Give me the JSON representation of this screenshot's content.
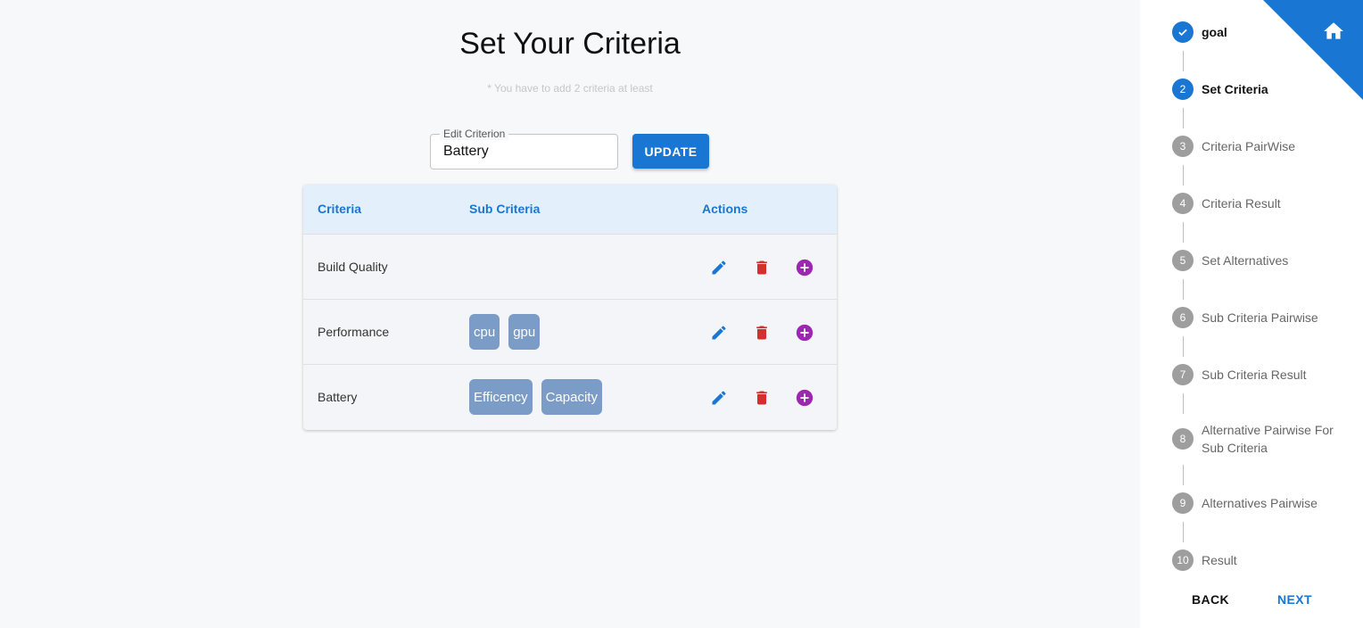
{
  "header": {
    "title": "Set Your Criteria",
    "hint": "* You have to add 2 criteria at least"
  },
  "edit_field": {
    "label": "Edit Criterion",
    "value": "Battery"
  },
  "update_label": "UPDATE",
  "table": {
    "headers": [
      "Criteria",
      "Sub Criteria",
      "Actions"
    ],
    "rows": [
      {
        "name": "Build Quality",
        "sub": []
      },
      {
        "name": "Performance",
        "sub": [
          "cpu",
          "gpu"
        ]
      },
      {
        "name": "Battery",
        "sub": [
          "Efficency",
          "Capacity"
        ]
      }
    ]
  },
  "stepper": {
    "steps": [
      {
        "num": "1",
        "label": "goal",
        "state": "done"
      },
      {
        "num": "2",
        "label": "Set Criteria",
        "state": "active"
      },
      {
        "num": "3",
        "label": "Criteria PairWise",
        "state": "pending"
      },
      {
        "num": "4",
        "label": "Criteria Result",
        "state": "pending"
      },
      {
        "num": "5",
        "label": "Set Alternatives",
        "state": "pending"
      },
      {
        "num": "6",
        "label": "Sub Criteria Pairwise",
        "state": "pending"
      },
      {
        "num": "7",
        "label": "Sub Criteria Result",
        "state": "pending"
      },
      {
        "num": "8",
        "label": "Alternative Pairwise For Sub Criteria",
        "state": "pending"
      },
      {
        "num": "9",
        "label": "Alternatives Pairwise",
        "state": "pending"
      },
      {
        "num": "10",
        "label": "Result",
        "state": "pending"
      }
    ],
    "back_label": "BACK",
    "next_label": "NEXT"
  },
  "colors": {
    "accent": "#1976d2",
    "delete": "#d32f2f",
    "add": "#9c27b0",
    "chip": "#7a9cc6"
  },
  "icons": {
    "edit": "pencil-icon",
    "delete": "trash-icon",
    "add": "plus-circle-icon",
    "home": "home-icon",
    "done": "check-icon"
  }
}
